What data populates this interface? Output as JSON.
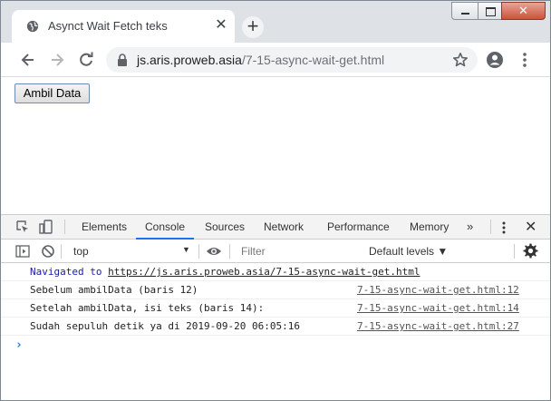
{
  "browser": {
    "tab_title": "Asynct Wait Fetch teks",
    "tab_icon": "globe-icon",
    "url_host": "js.aris.proweb.asia",
    "url_path": "/7-15-async-wait-get.html"
  },
  "page": {
    "button_label": "Ambil Data"
  },
  "devtools": {
    "tabs": [
      "Elements",
      "Console",
      "Sources",
      "Network",
      "Performance",
      "Memory"
    ],
    "active_tab": "Console",
    "more_label": "»",
    "context_value": "top",
    "filter_placeholder": "Filter",
    "levels_label": "Default levels ▼",
    "log": {
      "navigated_prefix": "Navigated to",
      "navigated_url": "https://js.aris.proweb.asia/7-15-async-wait-get.html",
      "lines": [
        {
          "text": "Sebelum ambilData (baris 12)",
          "source": "7-15-async-wait-get.html:12"
        },
        {
          "text": "Setelah ambilData, isi teks (baris 14):",
          "source": "7-15-async-wait-get.html:14"
        },
        {
          "text": "Sudah sepuluh detik ya di 2019-09-20 06:05:16",
          "source": "7-15-async-wait-get.html:27"
        }
      ],
      "prompt": "›"
    }
  },
  "colors": {
    "accent": "#1a73e8",
    "tabstrip": "#dee1e6"
  }
}
